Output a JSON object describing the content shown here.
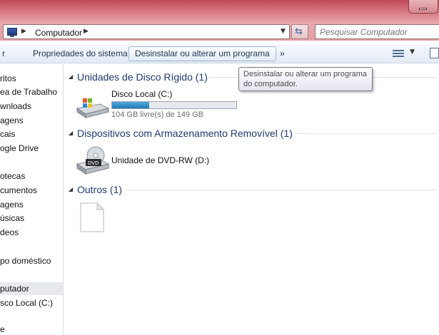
{
  "window": {
    "minimize_glyph": "minimize-icon"
  },
  "address_bar": {
    "breadcrumb_location": "Computador",
    "breadcrumb_icon": "computer-icon"
  },
  "search": {
    "placeholder": "Pesquisar Computador"
  },
  "toolbar": {
    "organize_partial": "r",
    "system_properties": "Propriedades do sistema",
    "uninstall_program": "Desinstalar ou alterar um programa",
    "overflow": "»"
  },
  "tooltip": {
    "line1": "Desinstalar ou alterar um programa",
    "line2": "do computador."
  },
  "nav": {
    "items": [
      "ritos",
      "ea de Trabalho",
      "wnloads",
      "agens",
      "cais",
      "ogle Drive",
      "otecas",
      "cumentos",
      "agens",
      "úsicas",
      "deos",
      "po doméstico",
      "putador",
      "sco Local (C:)",
      "e"
    ],
    "selected_index": 12
  },
  "content": {
    "groups": [
      {
        "title": "Unidades de Disco Rígido (1)",
        "items": [
          {
            "name": "Disco Local (C:)",
            "free_text": "104 GB livre(s) de 149 GB",
            "used_fraction": 0.3,
            "icon": "hard-drive-icon"
          }
        ]
      },
      {
        "title": "Dispositivos com Armazenamento Removível (1)",
        "items": [
          {
            "name": "Unidade de DVD-RW (D:)",
            "icon": "dvd-drive-icon",
            "badge": "DVD"
          }
        ]
      },
      {
        "title": "Outros (1)",
        "items": [
          {
            "name": "",
            "icon": "blank-file-icon"
          }
        ]
      }
    ]
  },
  "colors": {
    "frame": "#d97d86",
    "group_title": "#1e3a6e",
    "usage_bar": "#1d79b7",
    "toolbar_text": "#1e3350"
  }
}
